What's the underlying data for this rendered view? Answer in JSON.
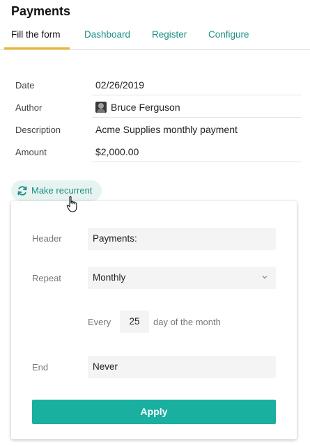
{
  "page": {
    "title": "Payments"
  },
  "tabs": [
    {
      "label": "Fill the form"
    },
    {
      "label": "Dashboard"
    },
    {
      "label": "Register"
    },
    {
      "label": "Configure"
    }
  ],
  "form": {
    "date": {
      "label": "Date",
      "value": "02/26/2019"
    },
    "author": {
      "label": "Author",
      "value": "Bruce Ferguson"
    },
    "description": {
      "label": "Description",
      "value": "Acme Supplies monthly payment"
    },
    "amount": {
      "label": "Amount",
      "value": "$2,000.00"
    }
  },
  "recurrent_button": {
    "label": "Make recurrent",
    "icon": "refresh-icon"
  },
  "recurrence": {
    "header": {
      "label": "Header",
      "value": "Payments:"
    },
    "repeat": {
      "label": "Repeat",
      "value": "Monthly"
    },
    "every": {
      "prefix": "Every",
      "value": "25",
      "suffix": "day of the month"
    },
    "end": {
      "label": "End",
      "value": "Never"
    },
    "apply_label": "Apply"
  },
  "colors": {
    "accent": "#1a8f86",
    "button": "#19b0a0",
    "tab_underline": "#f0b429",
    "chip_bg": "#e7f3f1"
  }
}
